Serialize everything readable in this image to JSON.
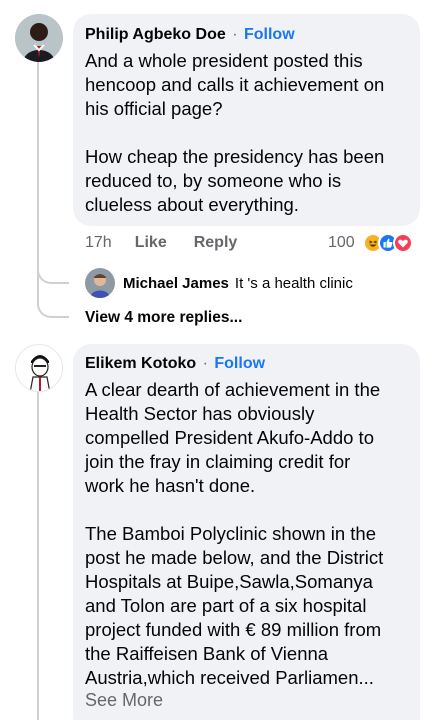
{
  "comments": [
    {
      "author": "Philip Agbeko Doe",
      "follow": "Follow",
      "separator": "·",
      "text": "And a whole president posted this\nhencoop and calls it achievement on\nhis official page?\n\nHow cheap the presidency has been\nreduced to, by someone who is\nclueless about everything.",
      "time": "17h",
      "like": "Like",
      "reply": "Reply",
      "reaction_count": "100",
      "reactions": [
        "haha-icon",
        "like-icon",
        "love-icon"
      ]
    },
    {
      "author": "Elikem Kotoko",
      "follow": "Follow",
      "separator": "·",
      "text": "A clear dearth of achievement in the\nHealth Sector has obviously\ncompelled President Akufo-Addo to\njoin the fray in claiming credit for\nwork he hasn't done.\n\nThe Bamboi Polyclinic shown in the\npost he made below, and the District\nHospitals at Buipe,Sawla,Somanya\nand Tolon are part of a six hospital\nproject funded with € 89 million from\nthe Raiffeisen Bank of Vienna\nAustria,which received Parliamen...",
      "see_more": "See More"
    }
  ],
  "reply": {
    "author": "Michael James",
    "text": "It 's a health clinic"
  },
  "view_more_replies": "View 4 more replies...",
  "colors": {
    "bubble": "#f0f2f5",
    "follow": "#1877f2",
    "meta": "#65676b",
    "haha": "#f7b125",
    "like": "#1877f2",
    "love": "#f33e58"
  }
}
